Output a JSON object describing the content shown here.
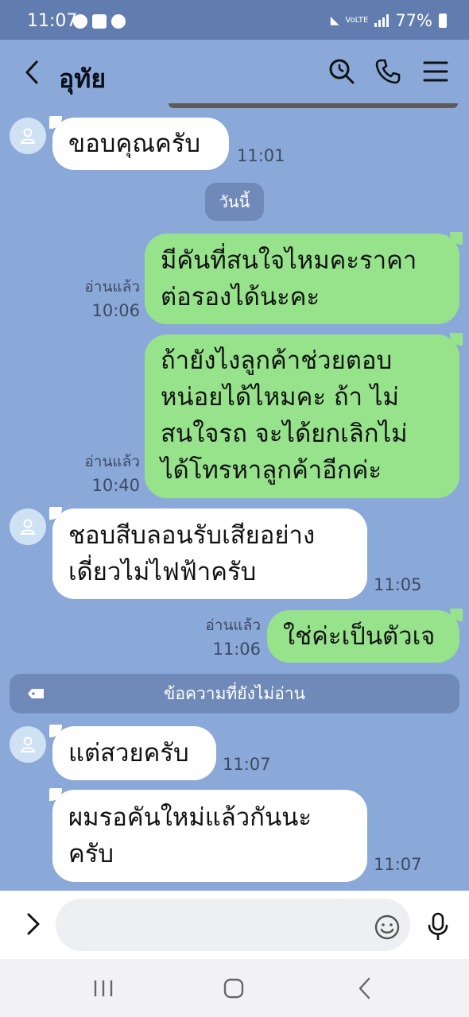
{
  "status_bar": {
    "time": "11:07",
    "battery": "77%",
    "notification_icons": [
      "messenger-icon",
      "gallery-icon",
      "facebook-icon"
    ],
    "network_label": "VoLTE"
  },
  "header": {
    "contact_name": "อุทัย",
    "icons": [
      "back-icon",
      "search-icon",
      "phone-icon",
      "menu-icon"
    ]
  },
  "chat": {
    "date_separator": "วันนี้",
    "unread_separator": "ข้อความที่ยังไม่อ่าน",
    "messages": [
      {
        "side": "in",
        "lines": [
          "ขอบคุณครับ"
        ],
        "time": "11:01"
      },
      {
        "side": "out",
        "lines": [
          "มีคันที่สนใจไหมคะราคา",
          "ต่อรองได้นะคะ"
        ],
        "read": "อ่านแล้ว",
        "time": "10:06"
      },
      {
        "side": "out",
        "lines": [
          "ถ้ายังไงลูกค้าช่วยตอบ",
          "หน่อยได้ไหมคะ ถ้า ไม่",
          "สนใจรถ จะได้ยกเลิกไม่",
          "ได้โทรหาลูกค้าอีกค่ะ"
        ],
        "read": "อ่านแล้ว",
        "time": "10:40"
      },
      {
        "side": "in",
        "lines": [
          "ชอบสีบลอนรับเสียอย่าง",
          "เดี่ยวไม่ไฟฟ้าครับ"
        ],
        "time": "11:05"
      },
      {
        "side": "out",
        "lines": [
          "ใช่ค่ะเป็นตัวเจ"
        ],
        "read": "อ่านแล้ว",
        "time": "11:06"
      },
      {
        "side": "in",
        "lines": [
          "แต่สวยครับ"
        ],
        "time": "11:07"
      },
      {
        "side": "in",
        "lines": [
          "ผมรอคันใหม่แล้วกันนะ",
          "ครับ"
        ],
        "time": "11:07"
      }
    ]
  },
  "input": {
    "placeholder": "",
    "icons": [
      "expand-icon",
      "emoji-icon",
      "microphone-icon"
    ]
  },
  "colors": {
    "chat_background": "#8aa9d9",
    "status_bar": "#617db0",
    "outgoing_bubble": "#97e38c",
    "incoming_bubble": "#ffffff",
    "separator_chip": "#6f8ab9"
  }
}
